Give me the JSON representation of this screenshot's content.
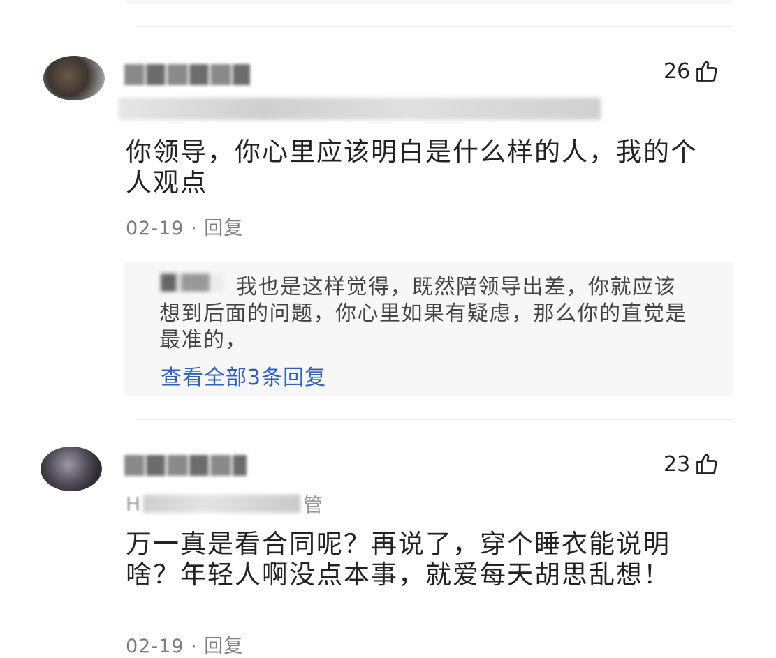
{
  "comments": [
    {
      "likes": "26",
      "text": "你领导，你心里应该明白是什么样的人，我的个人观点",
      "date": "02-19",
      "separator": "·",
      "reply_label": "回复",
      "reply_preview": {
        "text": "我也是这样觉得，既然陪领导出差，你就应该想到后面的问题，你心里如果有疑虑，那么你的直觉是最准的，",
        "view_all": "查看全部3条回复"
      }
    },
    {
      "likes": "23",
      "author_subtitle_visible": "H",
      "author_subtitle_suffix": "管",
      "text": "万一真是看合同呢？再说了，穿个睡衣能说明啥？年轻人啊没点本事，就爱每天胡思乱想！",
      "date": "02-19",
      "separator": "·",
      "reply_label": "回复"
    }
  ],
  "icons": {
    "like": "thumbs-up-outline-icon"
  },
  "colors": {
    "link": "#2f5fbf",
    "meta": "#7d7d7d",
    "reply_bg": "#f7f7f7"
  }
}
